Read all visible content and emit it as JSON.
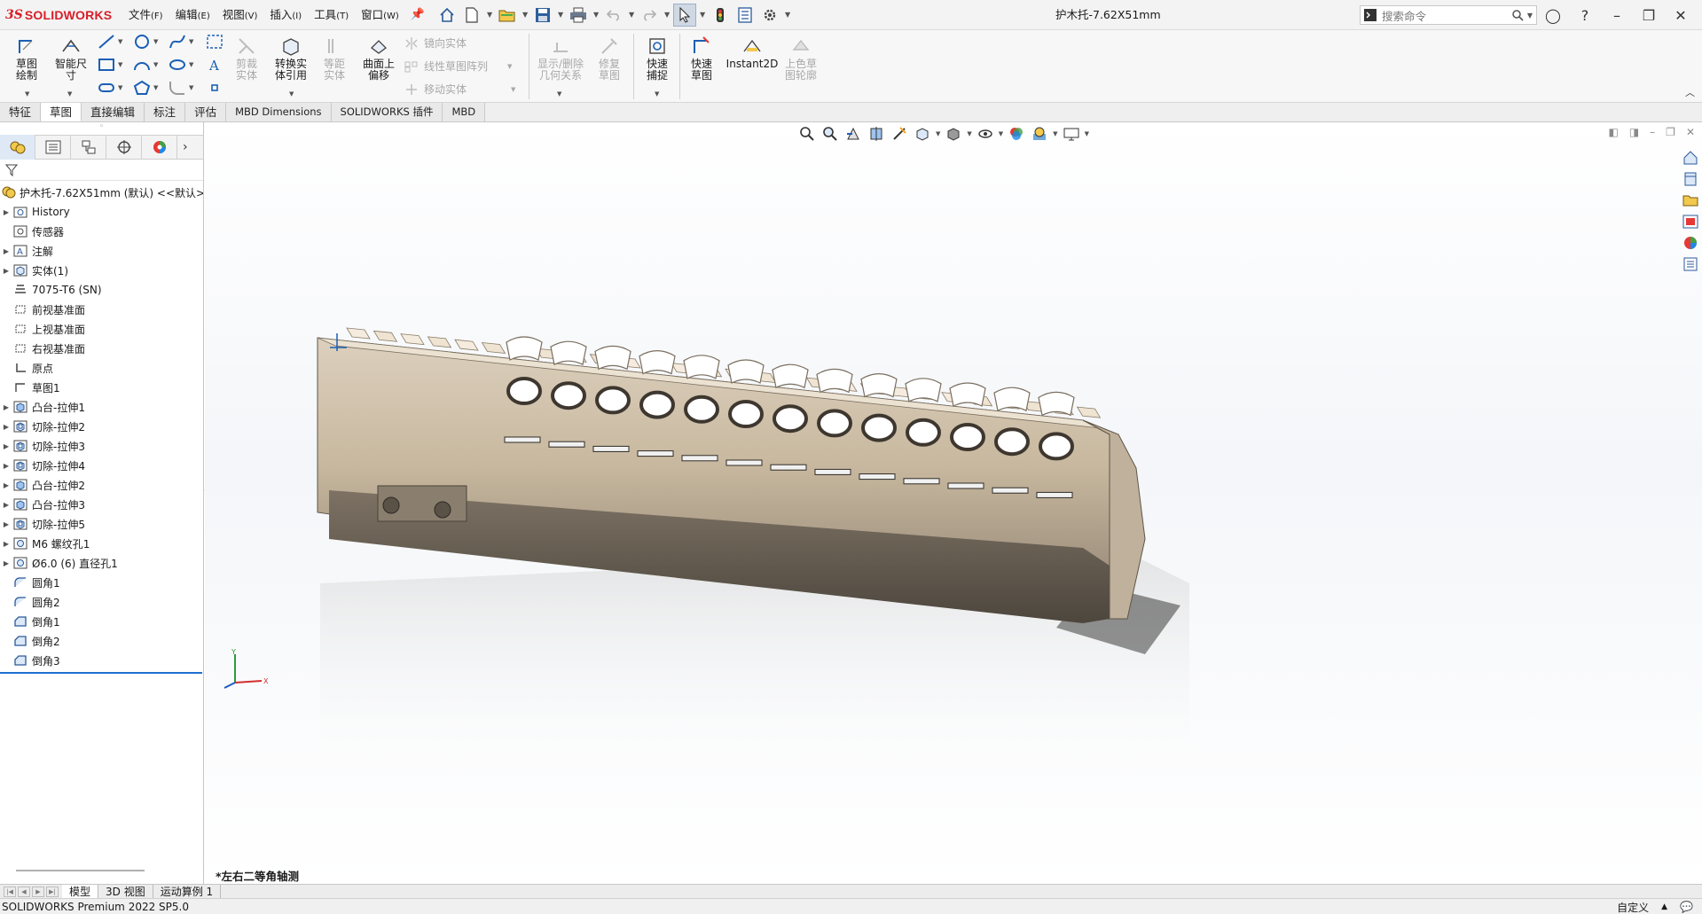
{
  "app": {
    "brand_ds": "3S",
    "brand": "SOLIDWORKS"
  },
  "menu": [
    {
      "label": "文件",
      "key": "(F)"
    },
    {
      "label": "编辑",
      "key": "(E)"
    },
    {
      "label": "视图",
      "key": "(V)"
    },
    {
      "label": "插入",
      "key": "(I)"
    },
    {
      "label": "工具",
      "key": "(T)"
    },
    {
      "label": "窗口",
      "key": "(W)"
    }
  ],
  "document_title": "护木托-7.62X51mm",
  "search": {
    "placeholder": "搜索命令"
  },
  "ribbon": {
    "sketch": "草图绘制",
    "smart_dim": "智能尺寸",
    "trim": "剪裁实体",
    "convert": "转换实体引用",
    "offset": "等距实体",
    "offset_surface": "曲面上偏移",
    "mirror": "镜向实体",
    "linear_pattern": "线性草图阵列",
    "move": "移动实体",
    "display_relations": "显示/删除几何关系",
    "repair": "修复草图",
    "quick_snaps": "快速捕捉",
    "rapid_sketch": "快速草图",
    "instant2d": "Instant2D",
    "shaded_contours": "上色草图轮廓"
  },
  "tabs": [
    "特征",
    "草图",
    "直接编辑",
    "标注",
    "评估",
    "MBD Dimensions",
    "SOLIDWORKS 插件",
    "MBD"
  ],
  "feature_tree": {
    "root": "护木托-7.62X51mm (默认) <<默认>",
    "items": [
      {
        "label": "History",
        "expandable": true,
        "icon": "history-folder-icon"
      },
      {
        "label": "传感器",
        "expandable": false,
        "icon": "sensor-icon"
      },
      {
        "label": "注解",
        "expandable": true,
        "icon": "annotation-icon"
      },
      {
        "label": "实体(1)",
        "expandable": true,
        "icon": "solid-bodies-icon"
      },
      {
        "label": "7075-T6 (SN)",
        "expandable": false,
        "icon": "material-icon"
      },
      {
        "label": "前视基准面",
        "expandable": false,
        "icon": "plane-icon"
      },
      {
        "label": "上视基准面",
        "expandable": false,
        "icon": "plane-icon"
      },
      {
        "label": "右视基准面",
        "expandable": false,
        "icon": "plane-icon"
      },
      {
        "label": "原点",
        "expandable": false,
        "icon": "origin-icon"
      },
      {
        "label": "草图1",
        "expandable": false,
        "icon": "sketch-icon"
      },
      {
        "label": "凸台-拉伸1",
        "expandable": true,
        "icon": "boss-extrude-icon"
      },
      {
        "label": "切除-拉伸2",
        "expandable": true,
        "icon": "cut-extrude-icon"
      },
      {
        "label": "切除-拉伸3",
        "expandable": true,
        "icon": "cut-extrude-icon"
      },
      {
        "label": "切除-拉伸4",
        "expandable": true,
        "icon": "cut-extrude-icon"
      },
      {
        "label": "凸台-拉伸2",
        "expandable": true,
        "icon": "boss-extrude-icon"
      },
      {
        "label": "凸台-拉伸3",
        "expandable": true,
        "icon": "boss-extrude-icon"
      },
      {
        "label": "切除-拉伸5",
        "expandable": true,
        "icon": "cut-extrude-icon"
      },
      {
        "label": "M6 螺纹孔1",
        "expandable": true,
        "icon": "hole-wizard-icon"
      },
      {
        "label": "Ø6.0 (6) 直径孔1",
        "expandable": true,
        "icon": "hole-wizard-icon"
      },
      {
        "label": "圆角1",
        "expandable": false,
        "icon": "fillet-icon"
      },
      {
        "label": "圆角2",
        "expandable": false,
        "icon": "fillet-icon"
      },
      {
        "label": "倒角1",
        "expandable": false,
        "icon": "chamfer-icon"
      },
      {
        "label": "倒角2",
        "expandable": false,
        "icon": "chamfer-icon"
      },
      {
        "label": "倒角3",
        "expandable": false,
        "icon": "chamfer-icon"
      }
    ]
  },
  "viewport": {
    "view_name": "*左右二等角轴测",
    "triad_x": "X",
    "triad_y": "Y"
  },
  "bottom_tabs": [
    "模型",
    "3D 视图",
    "运动算例 1"
  ],
  "status": {
    "product": "SOLIDWORKS Premium 2022 SP5.0",
    "units": "自定义"
  },
  "colors": {
    "brand_red": "#d71e28",
    "model_tan": "#e7d9c4",
    "model_dark": "#6b6256",
    "selection_blue": "#1f6fd1"
  }
}
